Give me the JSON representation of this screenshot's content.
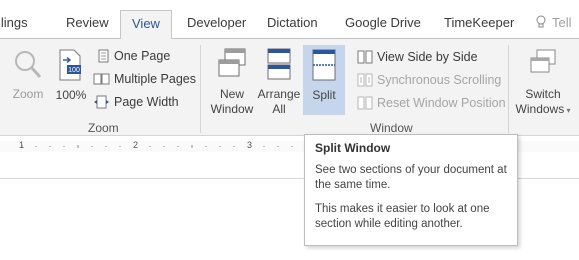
{
  "tabs": [
    {
      "label": "ilings"
    },
    {
      "label": "Review"
    },
    {
      "label": "View",
      "active": true
    },
    {
      "label": "Developer"
    },
    {
      "label": "Dictation"
    },
    {
      "label": "Google Drive"
    },
    {
      "label": "TimeKeeper"
    },
    {
      "label": "Tell"
    }
  ],
  "zoom_group": {
    "label": "Zoom",
    "zoom": "Zoom",
    "hundred": "100%",
    "one_page": "One Page",
    "multiple_pages": "Multiple Pages",
    "page_width": "Page Width"
  },
  "window_group": {
    "label": "Window",
    "new_window_1": "New",
    "new_window_2": "Window",
    "arrange_all_1": "Arrange",
    "arrange_all_2": "All",
    "split": "Split",
    "view_side_by_side": "View Side by Side",
    "synchronous_scrolling": "Synchronous Scrolling",
    "reset_window_position": "Reset Window Position",
    "switch_windows_1": "Switch",
    "switch_windows_2": "Windows"
  },
  "ruler": {
    "marks": [
      "1",
      "2",
      "3"
    ]
  },
  "tooltip": {
    "title": "Split Window",
    "line1": "See two sections of your document at the same time.",
    "line2": "This makes it easier to look at one section while editing another."
  },
  "colors": {
    "accent": "#2b579a",
    "selected": "#c5d6ec",
    "ribbon": "#f3f3f3"
  }
}
